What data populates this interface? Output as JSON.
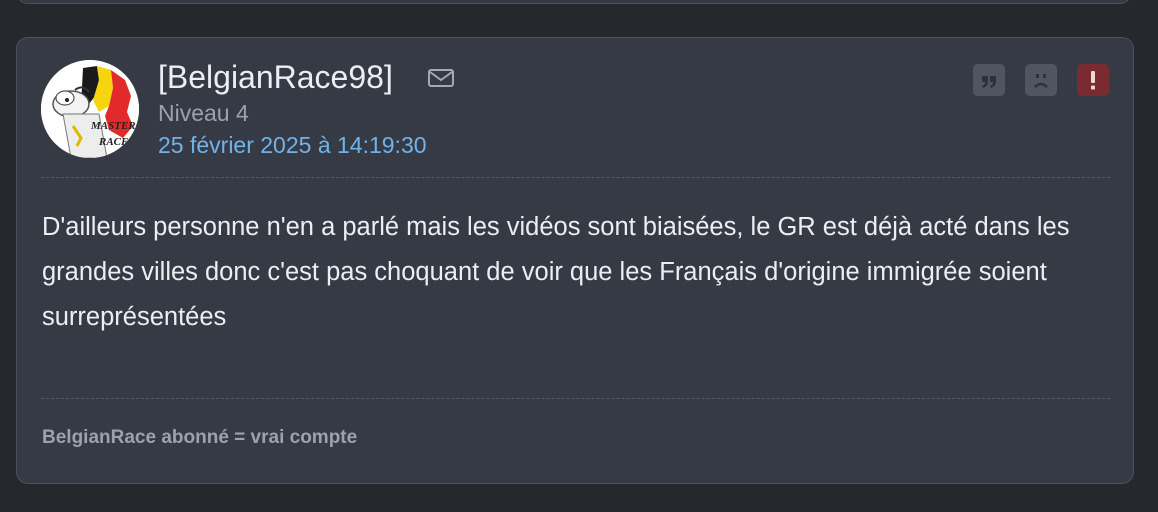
{
  "post": {
    "author": "[BelgianRace98]",
    "level": "Niveau 4",
    "date": "25 février 2025 à 14:19:30",
    "message": "D'ailleurs personne n'en a parlé mais les vidéos sont biaisées, le GR est déjà acté dans les grandes villes donc c'est pas choquant de voir que les Français d'origine immigrée soient surreprésentées",
    "signature": "BelgianRace abonné = vrai compte",
    "avatar": {
      "text_line1": "MASTER",
      "text_line2": "RACE",
      "colors": {
        "black": "#1a1a1a",
        "yellow": "#f6d40f",
        "red": "#e22a2a"
      }
    },
    "actions": [
      {
        "icon": "quote-icon",
        "color": "#51555f"
      },
      {
        "icon": "sad-face-icon",
        "color": "#51555f"
      },
      {
        "icon": "exclamation-icon",
        "color": "#7a2b31"
      }
    ]
  },
  "theme": {
    "background": "#27282d",
    "card": "#363a45",
    "accent_link": "#6fb3ea"
  }
}
